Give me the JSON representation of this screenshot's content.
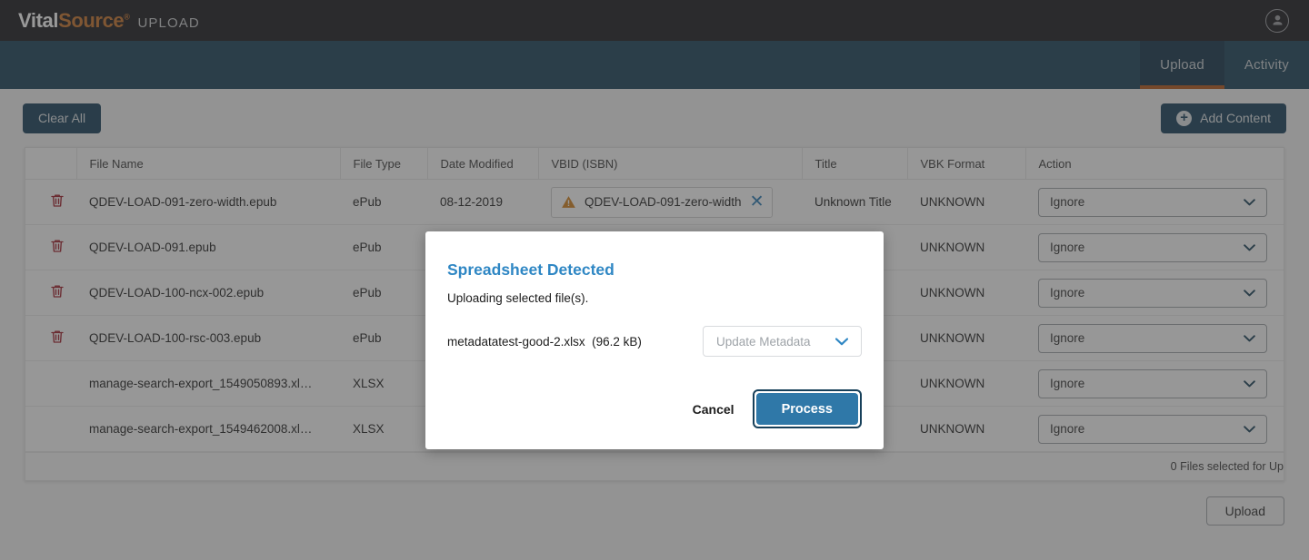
{
  "header": {
    "brand_vital": "Vital",
    "brand_source": "Source",
    "brand_tm": "®",
    "app_name": "UPLOAD",
    "avatar_icon": "account-circle-icon"
  },
  "nav": {
    "tabs": [
      {
        "label": "Upload",
        "active": true
      },
      {
        "label": "Activity",
        "active": false
      }
    ],
    "active_underline_color": "#b3561b"
  },
  "toolbar": {
    "clear_all_label": "Clear All",
    "add_content_label": "Add Content",
    "add_content_icon": "plus-circle-icon"
  },
  "table": {
    "columns": [
      {
        "key": "delete",
        "label": ""
      },
      {
        "key": "file_name",
        "label": "File Name"
      },
      {
        "key": "file_type",
        "label": "File Type"
      },
      {
        "key": "date_modified",
        "label": "Date Modified"
      },
      {
        "key": "vbid",
        "label": "VBID (ISBN)"
      },
      {
        "key": "title",
        "label": "Title"
      },
      {
        "key": "vbk_format",
        "label": "VBK Format"
      },
      {
        "key": "action",
        "label": "Action"
      }
    ],
    "rows": [
      {
        "deletable": true,
        "delete_icon": "trash-icon",
        "file_name": "QDEV-LOAD-091-zero-width.epub",
        "file_type": "ePub",
        "date_modified": "08-12-2019",
        "vbid_chip": {
          "present": true,
          "warn_icon": "warning-triangle-icon",
          "text": "QDEV-LOAD-091-zero-width",
          "clear_icon": "close-icon"
        },
        "title": "Unknown Title",
        "vbk_format": "UNKNOWN",
        "action": "Ignore"
      },
      {
        "deletable": true,
        "delete_icon": "trash-icon",
        "file_name": "QDEV-LOAD-091.epub",
        "file_type": "ePub",
        "date_modified": "",
        "vbid_chip": {
          "present": false,
          "warn_icon": "",
          "text": "",
          "clear_icon": ""
        },
        "title": "",
        "vbk_format": "UNKNOWN",
        "action": "Ignore"
      },
      {
        "deletable": true,
        "delete_icon": "trash-icon",
        "file_name": "QDEV-LOAD-100-ncx-002.epub",
        "file_type": "ePub",
        "date_modified": "",
        "vbid_chip": {
          "present": false,
          "warn_icon": "",
          "text": "",
          "clear_icon": ""
        },
        "title": "",
        "vbk_format": "UNKNOWN",
        "action": "Ignore"
      },
      {
        "deletable": true,
        "delete_icon": "trash-icon",
        "file_name": "QDEV-LOAD-100-rsc-003.epub",
        "file_type": "ePub",
        "date_modified": "",
        "vbid_chip": {
          "present": false,
          "warn_icon": "",
          "text": "",
          "clear_icon": ""
        },
        "title": "",
        "vbk_format": "UNKNOWN",
        "action": "Ignore"
      },
      {
        "deletable": false,
        "delete_icon": "",
        "file_name": "manage-search-export_1549050893.xl…",
        "file_type": "XLSX",
        "date_modified": "",
        "vbid_chip": {
          "present": false,
          "warn_icon": "",
          "text": "",
          "clear_icon": ""
        },
        "title": "",
        "vbk_format": "UNKNOWN",
        "action": "Ignore"
      },
      {
        "deletable": false,
        "delete_icon": "",
        "file_name": "manage-search-export_1549462008.xl…",
        "file_type": "XLSX",
        "date_modified": "",
        "vbid_chip": {
          "present": false,
          "warn_icon": "",
          "text": "",
          "clear_icon": ""
        },
        "title": "",
        "vbk_format": "UNKNOWN",
        "action": "Ignore"
      }
    ],
    "footer_status": "0 Files selected for Up"
  },
  "bottom": {
    "upload_label": "Upload"
  },
  "modal": {
    "title": "Spreadsheet Detected",
    "subtitle": "Uploading selected file(s).",
    "file_name": "metadatatest-good-2.xlsx",
    "file_size": "(96.2 kB)",
    "metadata_select_value": "Update Metadata",
    "metadata_select_icon": "chevron-down-icon",
    "cancel_label": "Cancel",
    "process_label": "Process"
  },
  "colors": {
    "header_bg": "#1b1b1f",
    "nav_bg": "#1a4158",
    "accent_orange": "#b3561b",
    "brand_orange": "#c8742a",
    "link_blue": "#2f87c4",
    "primary_button": "#17405a",
    "process_button": "#2f78a8",
    "danger_red": "#a01c28",
    "warning_amber": "#d4821e"
  }
}
